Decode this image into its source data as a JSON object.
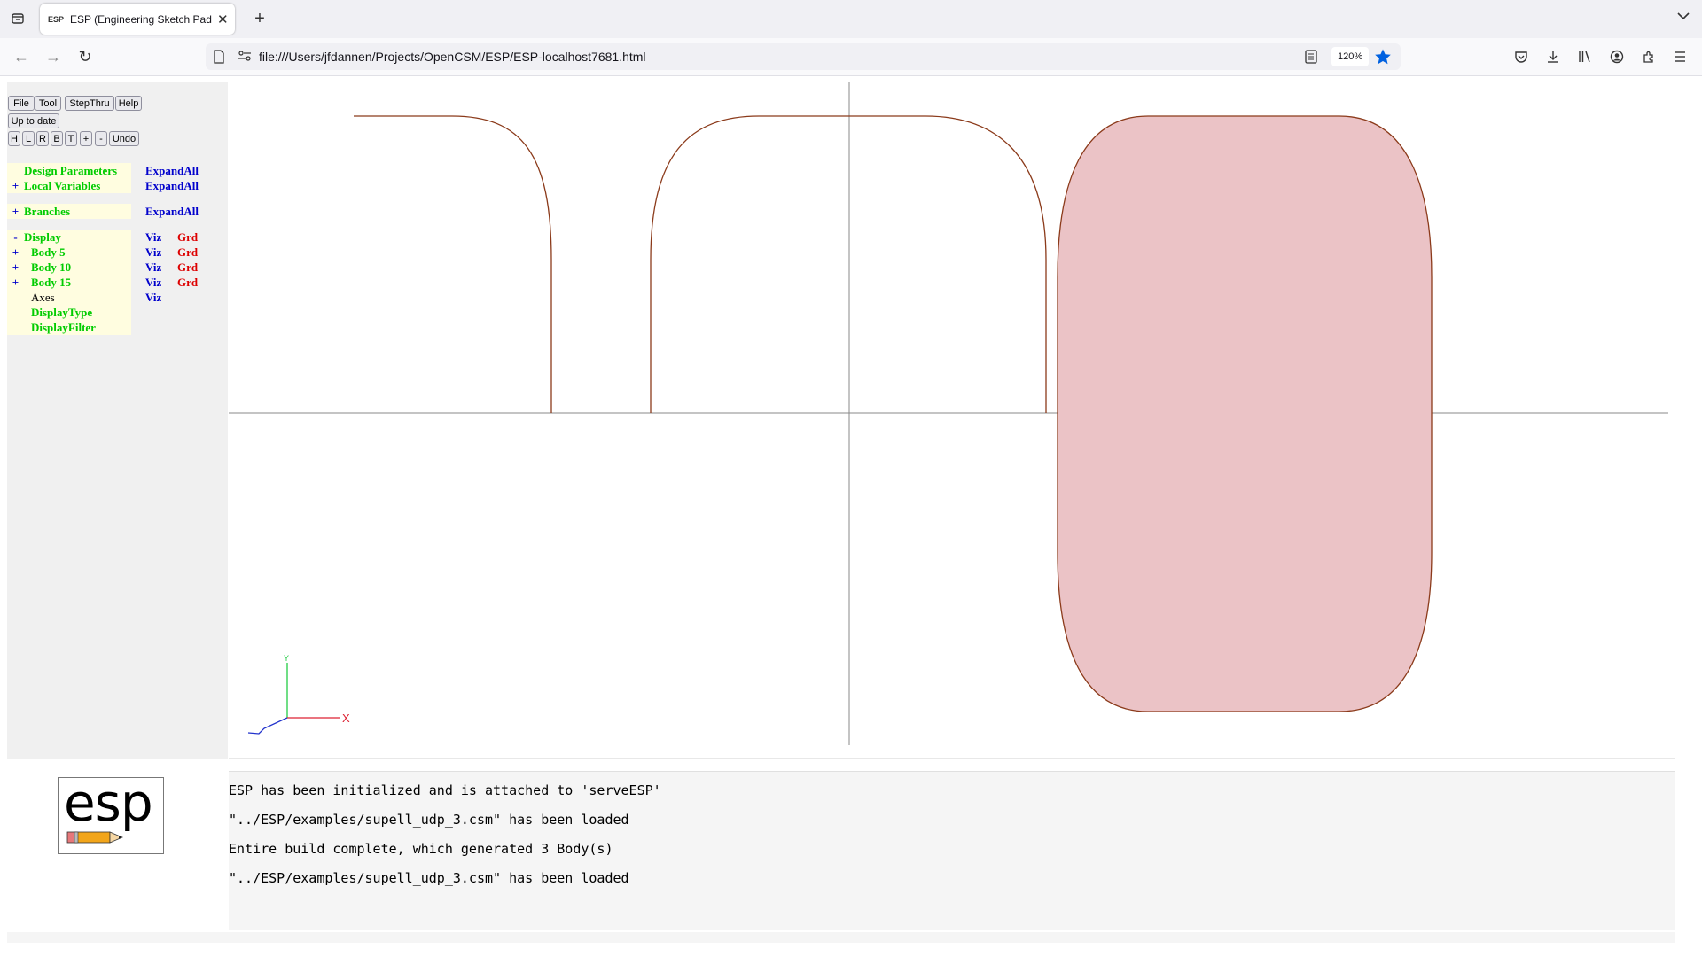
{
  "browser": {
    "tab_title": "ESP (Engineering Sketch Pad, V",
    "favicon_text": "ESP",
    "url": "file:///Users/jfdannen/Projects/OpenCSM/ESP/ESP-localhost7681.html",
    "zoom": "120%"
  },
  "toolbar": {
    "file": "File",
    "tool": "Tool",
    "stepthru": "StepThru",
    "help": "Help",
    "uptodate": "Up to date",
    "view_h": "H",
    "view_l": "L",
    "view_r": "R",
    "view_b": "B",
    "view_t": "T",
    "zoom_in": "+",
    "zoom_out": "-",
    "undo": "Undo"
  },
  "tree": {
    "design_params": {
      "plus": "",
      "label": "Design Parameters",
      "action": "ExpandAll"
    },
    "local_vars": {
      "plus": "+",
      "label": "Local Variables",
      "action": "ExpandAll"
    },
    "branches": {
      "plus": "+",
      "label": "Branches",
      "action": "ExpandAll"
    },
    "display": {
      "plus": "-",
      "label": "Display",
      "viz": "Viz",
      "grd": "Grd"
    },
    "body5": {
      "plus": "+",
      "label": "Body 5",
      "viz": "Viz",
      "grd": "Grd"
    },
    "body10": {
      "plus": "+",
      "label": "Body 10",
      "viz": "Viz",
      "grd": "Grd"
    },
    "body15": {
      "plus": "+",
      "label": "Body 15",
      "viz": "Viz",
      "grd": "Grd"
    },
    "axes": {
      "label": "Axes",
      "viz": "Viz"
    },
    "display_type": {
      "label": "DisplayType"
    },
    "display_filter": {
      "label": "DisplayFilter"
    }
  },
  "scene": {
    "axis_x_label": "X",
    "axis_y_label": "Y",
    "curve_color": "#8b3a1a",
    "fill_color": "#ebc3c6",
    "axes_color": "#888888"
  },
  "logo_text": "esp",
  "messages": [
    "ESP has been initialized and is attached to 'serveESP'",
    "\"../ESP/examples/supell_udp_3.csm\" has been loaded",
    "Entire build complete, which generated 3 Body(s)",
    "\"../ESP/examples/supell_udp_3.csm\" has been loaded"
  ]
}
